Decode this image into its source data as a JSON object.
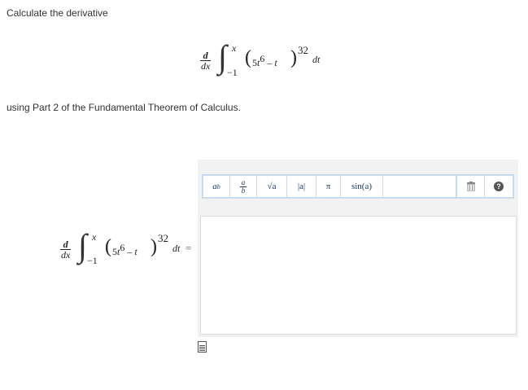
{
  "question": {
    "prompt": "Calculate the derivative",
    "instruction": "using Part 2 of the Fundamental Theorem of Calculus."
  },
  "math": {
    "d": "d",
    "dx": "dx",
    "integral": "∫",
    "upper_limit": "x",
    "lower_limit": "−1",
    "open_paren": "(",
    "base_coef": "5",
    "t": "t",
    "t_exp": "6",
    "minus": " – ",
    "close_paren": ")",
    "power": "32",
    "dt": "dt",
    "equals": "="
  },
  "toolbar": {
    "power_label": "a",
    "power_sup": "b",
    "frac_num": "a",
    "frac_den": "b",
    "sqrt_label": "√a",
    "abs_label": "|a|",
    "pi_label": "π",
    "sin_label": "sin(a)",
    "trash_icon": "trash-icon",
    "help_icon": "help-icon",
    "help_glyph": "?"
  },
  "answer": {
    "value": ""
  }
}
